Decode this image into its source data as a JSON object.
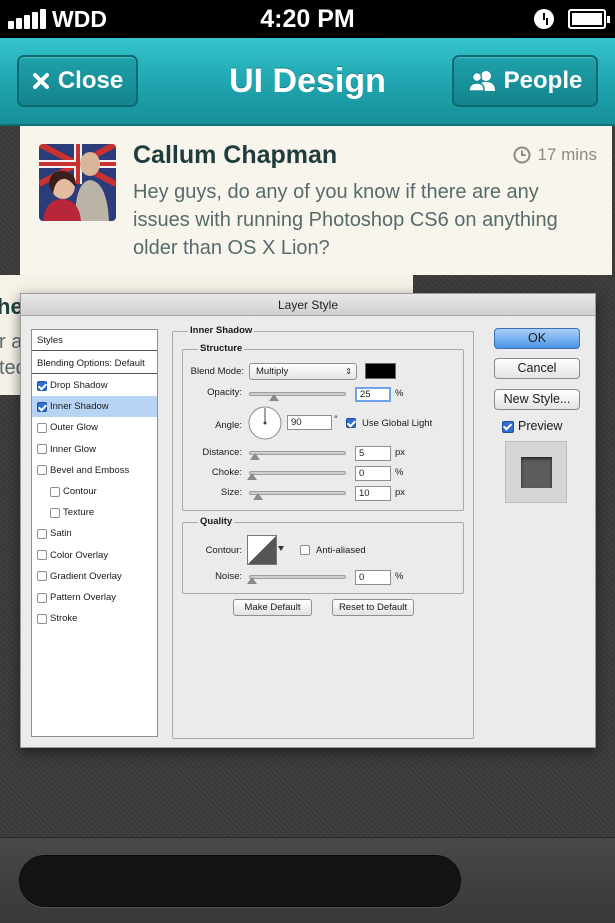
{
  "status_bar": {
    "carrier": "WDD",
    "time": "4:20 PM"
  },
  "nav": {
    "close_label": "Close",
    "title": "UI Design",
    "people_label": "People"
  },
  "post": {
    "author": "Callum Chapman",
    "time": "17 mins",
    "text": "Hey guys, do any of you know if there are any issues with running Photoshop CS6 on anything older than OS X Lion?"
  },
  "post2": {
    "name_fragment": "he",
    "line1": "r a",
    "line2": "ted"
  },
  "dialog": {
    "title": "Layer Style",
    "styles_header": "Styles",
    "blending_options": "Blending Options: Default",
    "styles": [
      {
        "label": "Drop Shadow",
        "checked": true
      },
      {
        "label": "Inner Shadow",
        "checked": true,
        "selected": true
      },
      {
        "label": "Outer Glow",
        "checked": false
      },
      {
        "label": "Inner Glow",
        "checked": false
      },
      {
        "label": "Bevel and Emboss",
        "checked": false
      },
      {
        "label": "Contour",
        "checked": false,
        "indent": true
      },
      {
        "label": "Texture",
        "checked": false,
        "indent": true
      },
      {
        "label": "Satin",
        "checked": false
      },
      {
        "label": "Color Overlay",
        "checked": false
      },
      {
        "label": "Gradient Overlay",
        "checked": false
      },
      {
        "label": "Pattern Overlay",
        "checked": false
      },
      {
        "label": "Stroke",
        "checked": false
      }
    ],
    "section_title": "Inner Shadow",
    "structure_label": "Structure",
    "blend_mode_label": "Blend Mode:",
    "blend_mode_value": "Multiply",
    "blend_color": "#000000",
    "opacity_label": "Opacity:",
    "opacity_value": "25",
    "angle_label": "Angle:",
    "angle_value": "90",
    "angle_unit": "°",
    "use_global_light": "Use Global Light",
    "distance_label": "Distance:",
    "distance_value": "5",
    "choke_label": "Choke:",
    "choke_value": "0",
    "size_label": "Size:",
    "size_value": "10",
    "unit_px": "px",
    "unit_pct": "%",
    "quality_label": "Quality",
    "contour_label": "Contour:",
    "anti_aliased": "Anti-aliased",
    "noise_label": "Noise:",
    "noise_value": "0",
    "make_default": "Make Default",
    "reset_default": "Reset to Default",
    "ok_label": "OK",
    "cancel_label": "Cancel",
    "new_style_label": "New Style...",
    "preview_label": "Preview"
  }
}
